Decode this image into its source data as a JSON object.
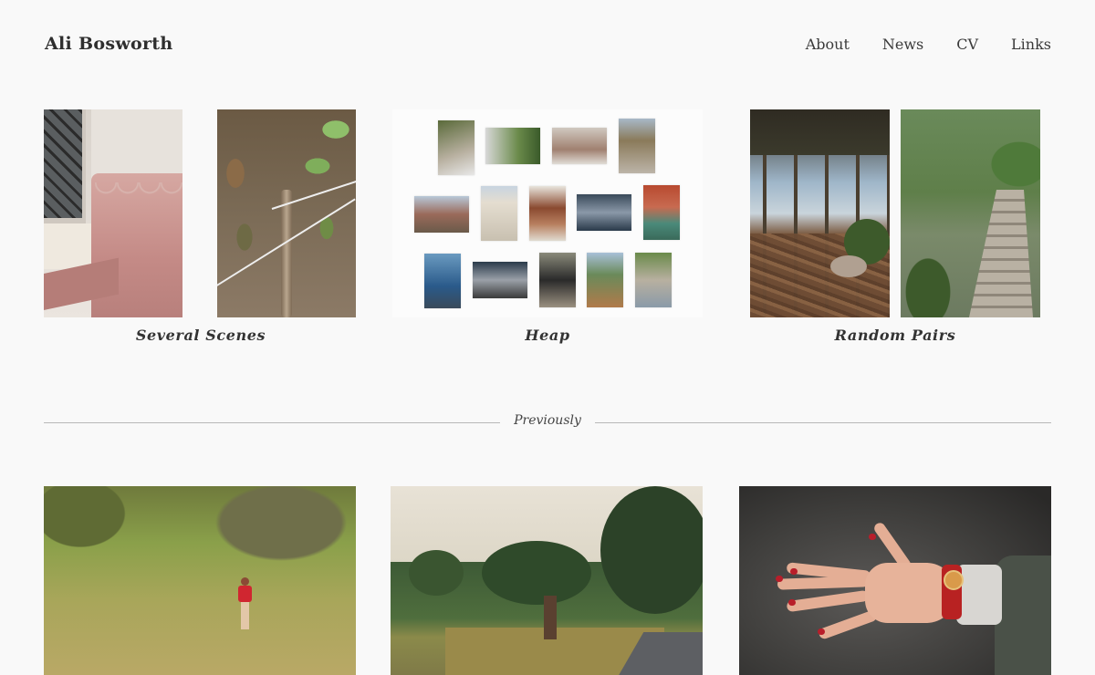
{
  "header": {
    "site_title": "Ali Bosworth",
    "nav": [
      "About",
      "News",
      "CV",
      "Links"
    ]
  },
  "projects": [
    {
      "title": "Several Scenes"
    },
    {
      "title": "Heap"
    },
    {
      "title": "Random Pairs"
    }
  ],
  "previously": {
    "label": "Previously"
  },
  "colors": {
    "background": "#f9f9f9",
    "text": "#333333",
    "divider": "#b8b8b8"
  }
}
